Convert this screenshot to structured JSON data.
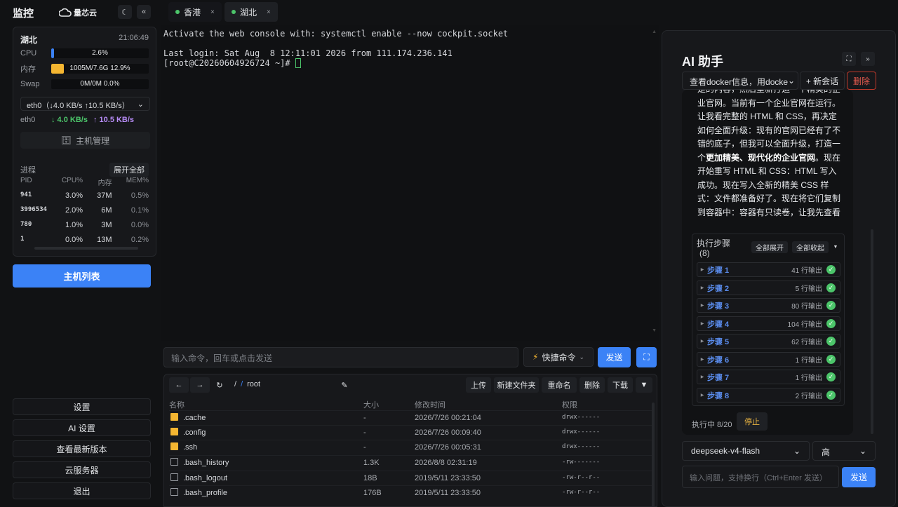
{
  "sidebar": {
    "title": "监控",
    "logo_text": "量芯云",
    "theme_icon": "☾",
    "collapse_icon": "«",
    "monitor": {
      "location": "湖北",
      "time": "21:06:49",
      "cpu": {
        "label": "CPU",
        "text": "2.6%",
        "fraction": 0.026,
        "color": "#3b82f6"
      },
      "mem": {
        "label": "内存",
        "text": "1005M/7.6G 12.9%",
        "fraction": 0.129,
        "color": "#f5b631"
      },
      "swap": {
        "label": "Swap",
        "text": "0M/0M 0.0%",
        "fraction": 0.0,
        "color": "#3b82f6"
      },
      "interface_select": "eth0（↓4.0 KB/s ↑10.5 KB/s）",
      "iface_name": "eth0",
      "iface_down": "↓ 4.0 KB/s",
      "iface_up": "↑ 10.5 KB/s",
      "host_manage": "主机管理"
    },
    "processes": {
      "title": "进程",
      "expand_all": "展开全部",
      "columns": [
        "PID",
        "CPU%",
        "内存",
        "MEM%"
      ],
      "rows": [
        {
          "pid": "941",
          "cpu": "3.0%",
          "mem": "37M",
          "memp": "0.5%"
        },
        {
          "pid": "3996534",
          "cpu": "2.0%",
          "mem": "6M",
          "memp": "0.1%"
        },
        {
          "pid": "780",
          "cpu": "1.0%",
          "mem": "3M",
          "memp": "0.0%"
        },
        {
          "pid": "1",
          "cpu": "0.0%",
          "mem": "13M",
          "memp": "0.2%"
        }
      ]
    },
    "host_list": "主机列表",
    "links": [
      "设置",
      "AI 设置",
      "查看最新版本",
      "云服务器",
      "退出"
    ]
  },
  "tabs": [
    {
      "label": "香港",
      "close": "×"
    },
    {
      "label": "湖北",
      "close": "×"
    }
  ],
  "terminal": {
    "lines": [
      "Activate the web console with: systemctl enable --now cockpit.socket",
      "",
      "Last login: Sat Aug  8 12:11:01 2026 from 111.174.236.141",
      "[root@C20260604926724 ~]# "
    ],
    "input_placeholder": "输入命令，回车或点击发送",
    "quick_cmd": "快捷命令",
    "send": "发送"
  },
  "files": {
    "nav": {
      "back": "←",
      "forward": "→",
      "refresh": "↻",
      "root": "/",
      "sep": "/",
      "dir": "root"
    },
    "tools": [
      "上传",
      "新建文件夹",
      "重命名",
      "删除",
      "下载"
    ],
    "columns": [
      "名称",
      "大小",
      "修改时间",
      "权限"
    ],
    "rows": [
      {
        "name": ".cache",
        "type": "folder",
        "size": "-",
        "mtime": "2026/7/26 00:21:04",
        "perm": "drwx------"
      },
      {
        "name": ".config",
        "type": "folder",
        "size": "-",
        "mtime": "2026/7/26 00:09:40",
        "perm": "drwx------"
      },
      {
        "name": ".ssh",
        "type": "folder",
        "size": "-",
        "mtime": "2026/7/26 00:05:31",
        "perm": "drwx------"
      },
      {
        "name": ".bash_history",
        "type": "file",
        "size": "1.3K",
        "mtime": "2026/8/8 02:31:19",
        "perm": "-rw-------"
      },
      {
        "name": ".bash_logout",
        "type": "file",
        "size": "18B",
        "mtime": "2019/5/11 23:33:50",
        "perm": "-rw-r--r--"
      },
      {
        "name": ".bash_profile",
        "type": "file",
        "size": "176B",
        "mtime": "2019/5/11 23:33:50",
        "perm": "-rw-r--r--"
      }
    ]
  },
  "ai": {
    "title": "AI 助手",
    "session_select": "查看docker信息，用docke",
    "new_session": "+ 新会话",
    "delete": "删除",
    "message_segments": [
      {
        "text": "是的内容，然后重新打造一个精美的企业官网。当前有一个企业官网在运行。让我看完整的 HTML 和 CSS，再决定如何全面升级：现有的官网已经有了不错的底子，但我可以全面升级，打造一个",
        "bold": false
      },
      {
        "text": "更加精美、现代化的企业官网",
        "bold": true
      },
      {
        "text": "。现在开始重写 HTML 和 CSS：HTML 写入成功。现在写入全新的精美 CSS 样式：文件都准备好了。现在将它们复制到容器中：容器有只读卷，让我先查看",
        "bold": false
      }
    ],
    "steps": {
      "title": "执行步骤",
      "count": "(8)",
      "expand_all": "全部展开",
      "collapse_all": "全部收起",
      "items": [
        {
          "name": "步骤 1",
          "out": "41 行输出"
        },
        {
          "name": "步骤 2",
          "out": "5 行输出"
        },
        {
          "name": "步骤 3",
          "out": "80 行输出"
        },
        {
          "name": "步骤 4",
          "out": "104 行输出"
        },
        {
          "name": "步骤 5",
          "out": "62 行输出"
        },
        {
          "name": "步骤 6",
          "out": "1 行输出"
        },
        {
          "name": "步骤 7",
          "out": "1 行输出"
        },
        {
          "name": "步骤 8",
          "out": "2 行输出"
        }
      ]
    },
    "exec_status": "执行中 8/20",
    "stop": "停止",
    "model": "deepseek-v4-flash",
    "level": "高",
    "input_placeholder": "输入问题，支持换行（Ctrl+Enter 发送）",
    "send": "发送"
  },
  "colors": {
    "accent": "#3b82f6",
    "ok": "#4cc56a",
    "danger": "#e45b4e"
  }
}
